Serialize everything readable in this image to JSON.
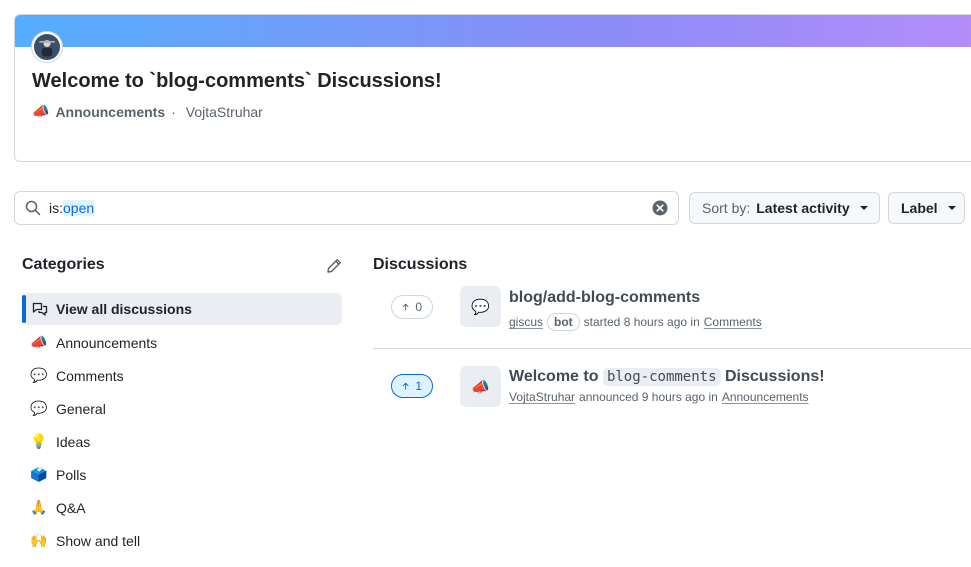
{
  "pinned": {
    "title": "Welcome to `blog-comments` Discussions!",
    "category_emoji": "📣",
    "category": "Announcements",
    "separator": "·",
    "author": "VojtaStruhar"
  },
  "search": {
    "prefix": "is:",
    "highlight": "open"
  },
  "sort": {
    "label": "Sort by:",
    "value": "Latest activity"
  },
  "label_button": "Label",
  "sidebar": {
    "heading": "Categories",
    "items": [
      {
        "emoji": "",
        "label": "View all discussions"
      },
      {
        "emoji": "📣",
        "label": "Announcements"
      },
      {
        "emoji": "💬",
        "label": "Comments"
      },
      {
        "emoji": "💬",
        "label": "General"
      },
      {
        "emoji": "💡",
        "label": "Ideas"
      },
      {
        "emoji": "🗳️",
        "label": "Polls"
      },
      {
        "emoji": "🙏",
        "label": "Q&A"
      },
      {
        "emoji": "🙌",
        "label": "Show and tell"
      }
    ]
  },
  "discussions": {
    "heading": "Discussions",
    "items": [
      {
        "votes": "0",
        "emoji": "💬",
        "title": "blog/add-blog-comments",
        "author": "giscus",
        "badge": "bot",
        "action": "started 8 hours ago in",
        "category": "Comments"
      },
      {
        "votes": "1",
        "emoji": "📣",
        "title_pre": "Welcome to",
        "title_code": "blog-comments",
        "title_post": "Discussions!",
        "author": "VojtaStruhar",
        "action": "announced 9 hours ago in",
        "category": "Announcements"
      }
    ]
  },
  "colors": {
    "accent": "#0969da",
    "banner_start": "#54aeff",
    "banner_end": "#b48dfa"
  }
}
